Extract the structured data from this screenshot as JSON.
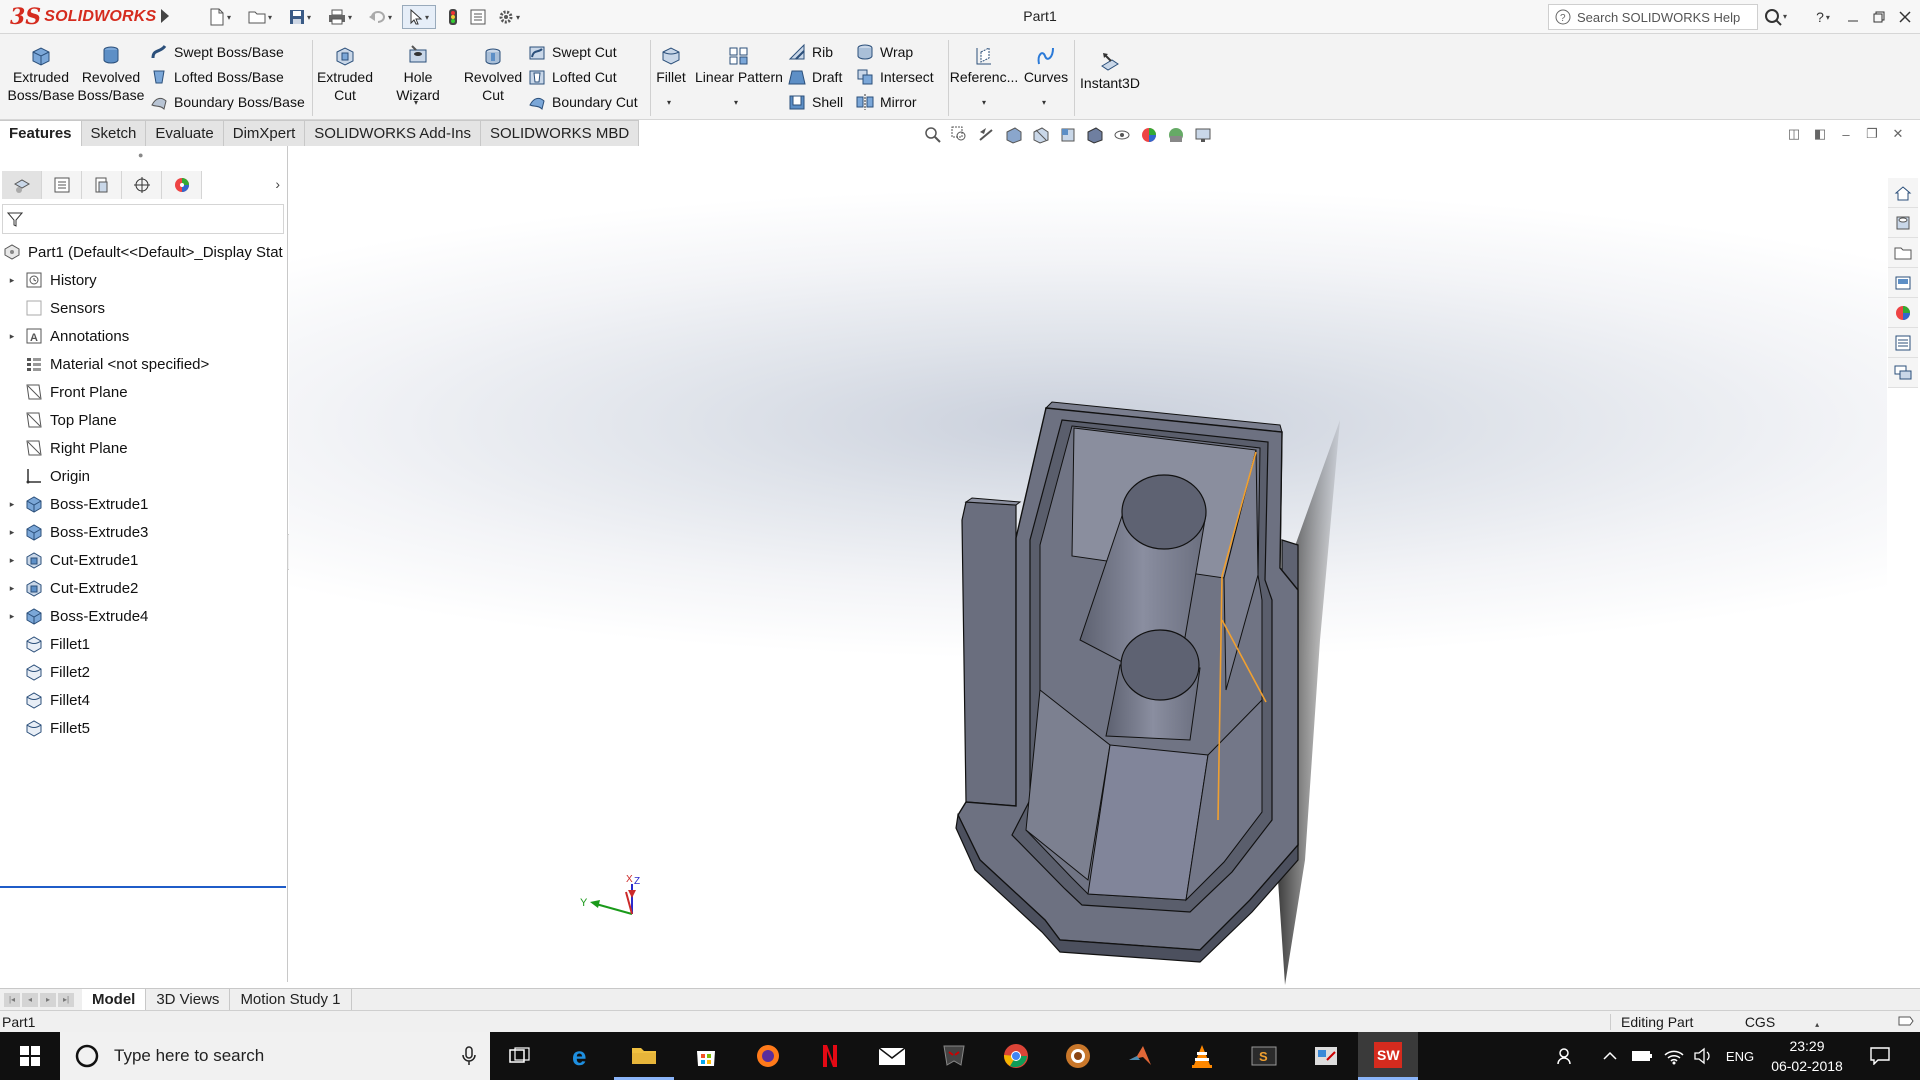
{
  "app": {
    "brand_ds": "3S",
    "brand_name": "SOLIDWORKS",
    "document_title": "Part1",
    "search_placeholder": "Search SOLIDWORKS Help",
    "help_label": "?"
  },
  "command_manager": {
    "extruded_boss": [
      "Extruded",
      "Boss/Base"
    ],
    "revolved_boss": [
      "Revolved",
      "Boss/Base"
    ],
    "swept_boss": "Swept Boss/Base",
    "lofted_boss": "Lofted Boss/Base",
    "boundary_boss": "Boundary Boss/Base",
    "extruded_cut": [
      "Extruded",
      "Cut"
    ],
    "hole_wizard": "Hole Wizard",
    "revolved_cut": [
      "Revolved",
      "Cut"
    ],
    "swept_cut": "Swept Cut",
    "lofted_cut": "Lofted Cut",
    "boundary_cut": "Boundary Cut",
    "fillet": "Fillet",
    "linear_pattern": "Linear Pattern",
    "rib": "Rib",
    "draft": "Draft",
    "shell": "Shell",
    "wrap": "Wrap",
    "intersect": "Intersect",
    "mirror": "Mirror",
    "reference": "Referenc...",
    "curves": "Curves",
    "instant3d": "Instant3D"
  },
  "tabs": [
    "Features",
    "Sketch",
    "Evaluate",
    "DimXpert",
    "SOLIDWORKS Add-Ins",
    "SOLIDWORKS MBD"
  ],
  "feature_tree": {
    "root": "Part1  (Default<<Default>_Display Stat",
    "items": [
      {
        "label": "History",
        "icon": "history-icon",
        "expandable": true
      },
      {
        "label": "Sensors",
        "icon": "sensors-icon",
        "expandable": false
      },
      {
        "label": "Annotations",
        "icon": "annotations-icon",
        "expandable": true
      },
      {
        "label": "Material <not specified>",
        "icon": "material-icon",
        "expandable": false
      },
      {
        "label": "Front Plane",
        "icon": "plane-icon",
        "expandable": false
      },
      {
        "label": "Top Plane",
        "icon": "plane-icon",
        "expandable": false
      },
      {
        "label": "Right Plane",
        "icon": "plane-icon",
        "expandable": false
      },
      {
        "label": "Origin",
        "icon": "origin-icon",
        "expandable": false
      },
      {
        "label": "Boss-Extrude1",
        "icon": "boss-extrude-icon",
        "expandable": true
      },
      {
        "label": "Boss-Extrude3",
        "icon": "boss-extrude-icon",
        "expandable": true
      },
      {
        "label": "Cut-Extrude1",
        "icon": "cut-extrude-icon",
        "expandable": true
      },
      {
        "label": "Cut-Extrude2",
        "icon": "cut-extrude-icon",
        "expandable": true
      },
      {
        "label": "Boss-Extrude4",
        "icon": "boss-extrude-icon",
        "expandable": true
      },
      {
        "label": "Fillet1",
        "icon": "fillet-icon",
        "expandable": false
      },
      {
        "label": "Fillet2",
        "icon": "fillet-icon",
        "expandable": false
      },
      {
        "label": "Fillet4",
        "icon": "fillet-icon",
        "expandable": false
      },
      {
        "label": "Fillet5",
        "icon": "fillet-icon",
        "expandable": false
      }
    ]
  },
  "triad": {
    "x": "X",
    "y": "Y",
    "z": "Z"
  },
  "bottom_tabs": [
    "Model",
    "3D Views",
    "Motion Study 1"
  ],
  "status_bar": {
    "document": "Part1",
    "mode": "Editing Part",
    "units": "CGS"
  },
  "taskbar": {
    "search_placeholder": "Type here to search",
    "language": "ENG",
    "time": "23:29",
    "date": "06-02-2018",
    "sw_badge": "SW"
  },
  "colors": {
    "brand": "#d52b1e",
    "model_face": "#6e7280",
    "model_top": "#8c90a0",
    "edge": "#111111",
    "selected_edge": "#f0a030",
    "rollback_bar": "#1f5cc8"
  }
}
